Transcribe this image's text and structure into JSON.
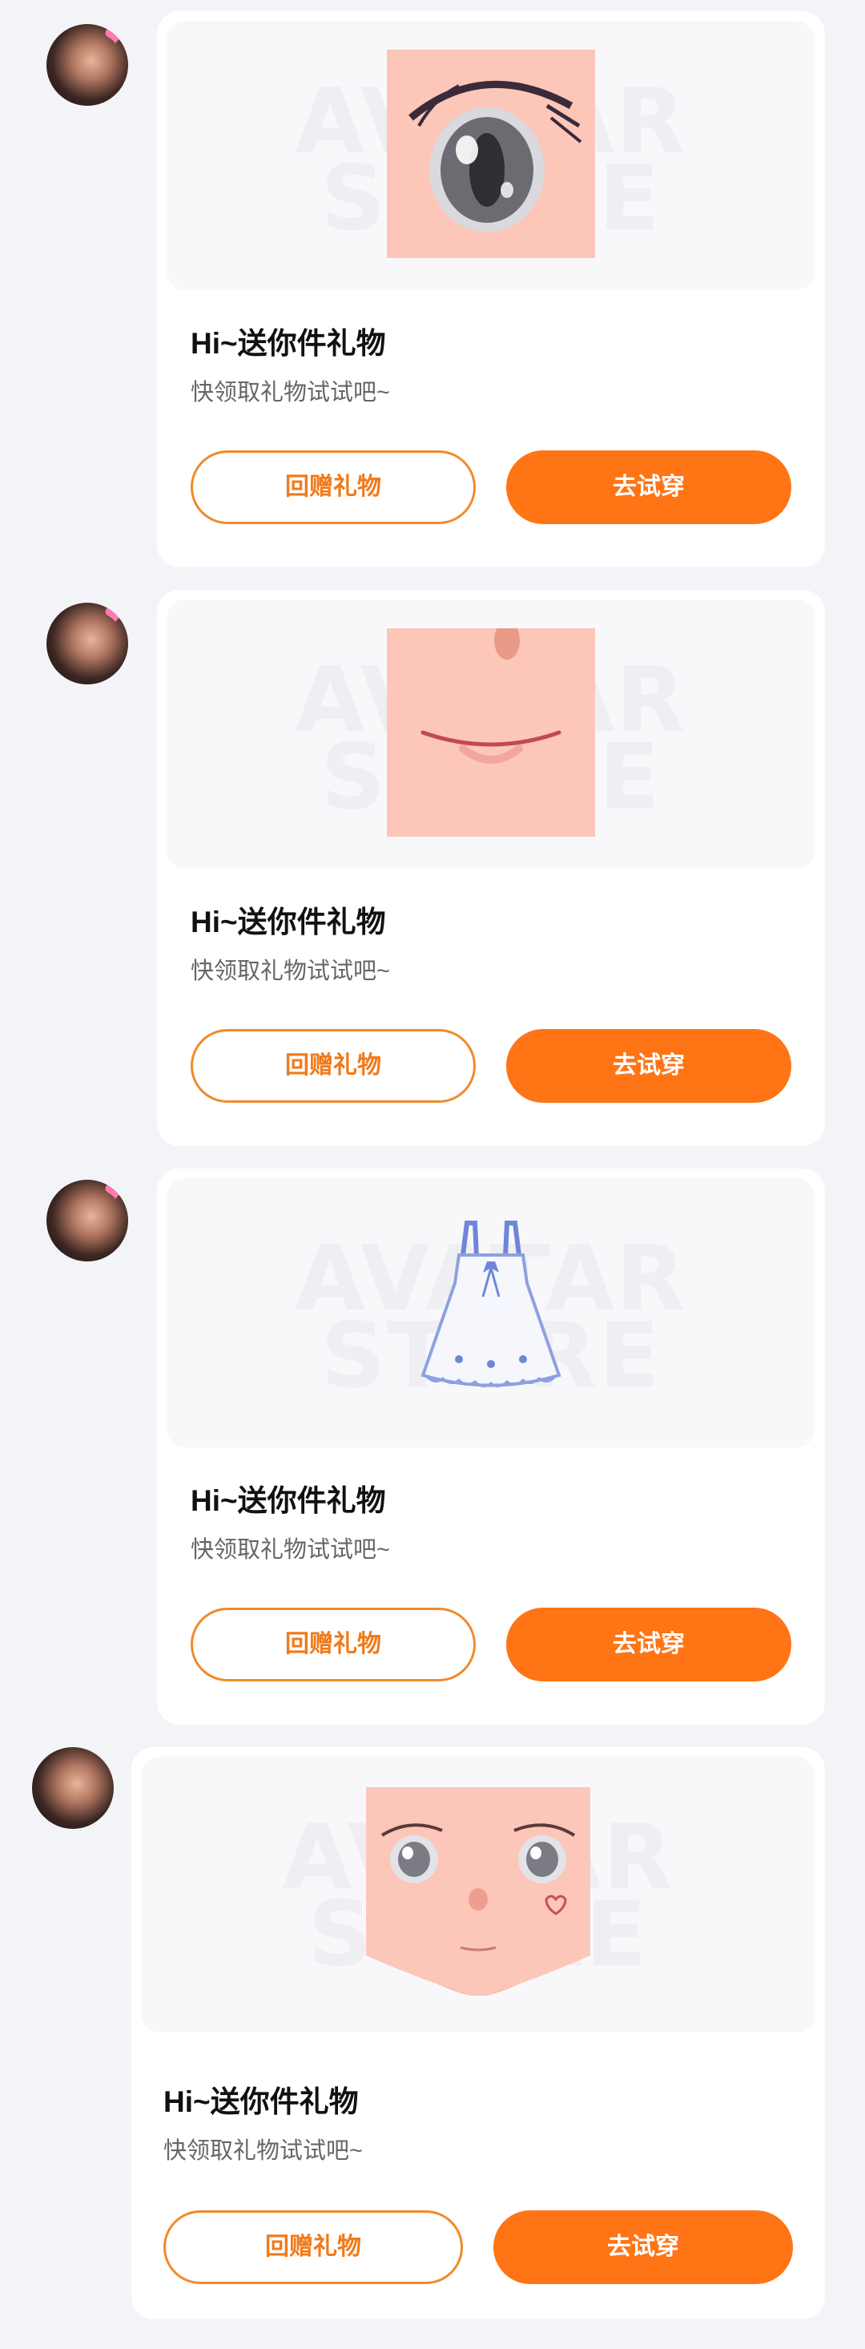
{
  "messages": [
    {
      "title": "Hi~送你件礼物",
      "subtitle": "快领取礼物试试吧~",
      "return_gift": "回赠礼物",
      "try_on": "去试穿",
      "item_icon": "anime-eye-icon",
      "watermark": "AVATAR STORE"
    },
    {
      "title": "Hi~送你件礼物",
      "subtitle": "快领取礼物试试吧~",
      "return_gift": "回赠礼物",
      "try_on": "去试穿",
      "item_icon": "mouth-smile-icon",
      "watermark": "AVATAR STORE"
    },
    {
      "title": "Hi~送你件礼物",
      "subtitle": "快领取礼物试试吧~",
      "return_gift": "回赠礼物",
      "try_on": "去试穿",
      "item_icon": "white-dress-icon",
      "watermark": "AVATAR STORE"
    },
    {
      "title": "Hi~送你件礼物",
      "subtitle": "快领取礼物试试吧~",
      "return_gift": "回赠礼物",
      "try_on": "去试穿",
      "item_icon": "anime-face-icon",
      "watermark": "AVATAR STORE"
    }
  ],
  "colors": {
    "page_background": "#f3f4f8",
    "accent_orange": "#ff7414",
    "outline_orange": "#f08a2a",
    "title_text": "#111111",
    "subtitle_text": "#666666"
  }
}
